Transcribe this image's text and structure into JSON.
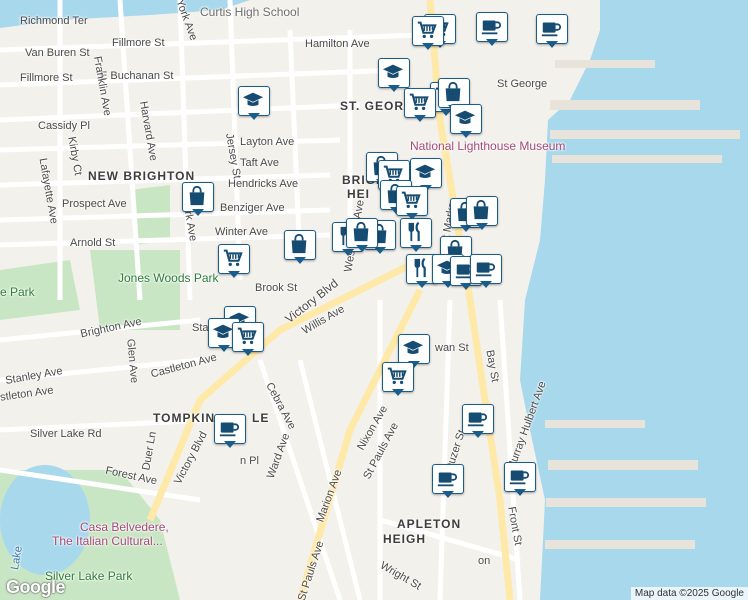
{
  "colors": {
    "water": "#a8d8ec",
    "land": "#f3f1ec",
    "park": "#c9e6c4",
    "road": "#ffffff",
    "major_road": "#ffe9a8",
    "pin_border": "#1b5d8a",
    "pin_icon": "#164c72"
  },
  "labels": {
    "curtis_high_school": "Curtis High School",
    "richmond_ter": "Richmond Ter",
    "york_ave": "York Ave",
    "van_buren_st": "Van Buren St",
    "fillmore_st_1": "Fillmore St",
    "fillmore_st_2": "Fillmore St",
    "e_buchanan_st": "E Buchanan St",
    "franklin_ave": "Franklin Ave",
    "hamilton_ave": "Hamilton Ave",
    "st_george_area": "ST. GEORGE",
    "st_george_station": "St George",
    "cassidy_pl": "Cassidy Pl",
    "harvard_ave": "Harvard Ave",
    "layton_ave": "Layton Ave",
    "taft_ave": "Taft Ave",
    "new_brighton": "NEW BRIGHTON",
    "hendricks_ave": "Hendricks Ave",
    "lafayette_ave": "Lafayette Ave",
    "kirby_ct": "Kirby Ct",
    "national_lighthouse_museum": "National Lighthouse Museum",
    "brighton_heights_1": "BRIGH",
    "brighton_heights_2": "HEI",
    "prospect_ave": "Prospect Ave",
    "benziger_ave": "Benziger Ave",
    "arnold_st": "Arnold St",
    "york_ave_2": "York Ave",
    "winter_ave": "Winter Ave",
    "westervelt_ave": "Westervelt Ave",
    "st_marks": "St Marks",
    "jersey_st": "Jersey St",
    "jones_woods_park": "Jones Woods Park",
    "brook_st": "Brook St",
    "e_park": "e Park",
    "victory_blvd": "Victory Blvd",
    "willis_ave": "Willis Ave",
    "brighton_ave": "Brighton Ave",
    "stanley_ave_short": "Stan",
    "glen_ave": "Glen Ave",
    "stanley_ave": "Stanley Ave",
    "castleton_ave": "Castleton Ave",
    "stleton_ave": "stleton Ave",
    "cebra_ave": "Cebra Ave",
    "swan_st": "wan St",
    "bay_st": "Bay St",
    "tompkinsville": "TOMPKIN",
    "tompkinsville_end": "LE",
    "silver_lake_rd": "Silver Lake Rd",
    "nixon_ave": "Nixon Ave",
    "murray_hulbert_ave": "Murray Hulbert Ave",
    "duer_ln": "Duer Ln",
    "ward_ave": "Ward Ave",
    "victory_blvd_2": "Victory Blvd",
    "st_pauls_ave": "St Pauls Ave",
    "van_duzer_st": "Van Duzer St",
    "forest_ave": "Forest Ave",
    "marion_ave": "Marion Ave",
    "casa_belvedere_1": "Casa Belvedere,",
    "casa_belvedere_2": "The Italian Cultural...",
    "front_st": "Front St",
    "stapleton_heights_1": "APLETON",
    "stapleton_heights_2": "HEIGH",
    "silver_lake_park": "Silver Lake Park",
    "lake": "Lake",
    "wright_st": "Wright St",
    "st_pauls_ave_2": "St Pauls Ave",
    "gordon_pl": "n Pl",
    "station_short": "on"
  },
  "pins": [
    {
      "icon": "cart-icon"
    },
    {
      "icon": "cup-icon"
    },
    {
      "icon": "cup-icon"
    },
    {
      "icon": "cap-icon"
    },
    {
      "icon": "cart-icon"
    },
    {
      "icon": "cart-icon"
    },
    {
      "icon": "cap-icon"
    },
    {
      "icon": "cart-icon"
    },
    {
      "icon": "bag-icon"
    },
    {
      "icon": "cap-icon"
    },
    {
      "icon": "bag-icon"
    },
    {
      "icon": "cap-icon"
    },
    {
      "icon": "cart-icon"
    },
    {
      "icon": "bag-icon"
    },
    {
      "icon": "cart-icon"
    },
    {
      "icon": "bag-icon"
    },
    {
      "icon": "bag-icon"
    },
    {
      "icon": "fork-icon"
    },
    {
      "icon": "fork-icon"
    },
    {
      "icon": "bag-icon"
    },
    {
      "icon": "bag-icon"
    },
    {
      "icon": "fork-icon"
    },
    {
      "icon": "bag-icon"
    },
    {
      "icon": "bag-icon"
    },
    {
      "icon": "cart-icon"
    },
    {
      "icon": "bag-icon"
    },
    {
      "icon": "cap-icon"
    },
    {
      "icon": "cup-icon"
    },
    {
      "icon": "cup-icon"
    },
    {
      "icon": "cap-icon"
    },
    {
      "icon": "cap-icon"
    },
    {
      "icon": "cart-icon"
    },
    {
      "icon": "cap-icon"
    },
    {
      "icon": "cart-icon"
    },
    {
      "icon": "cup-icon"
    },
    {
      "icon": "cup-icon"
    },
    {
      "icon": "cup-icon"
    },
    {
      "icon": "cup-icon"
    }
  ],
  "attribution": "Map data ©2025 Google",
  "logo": "Google"
}
